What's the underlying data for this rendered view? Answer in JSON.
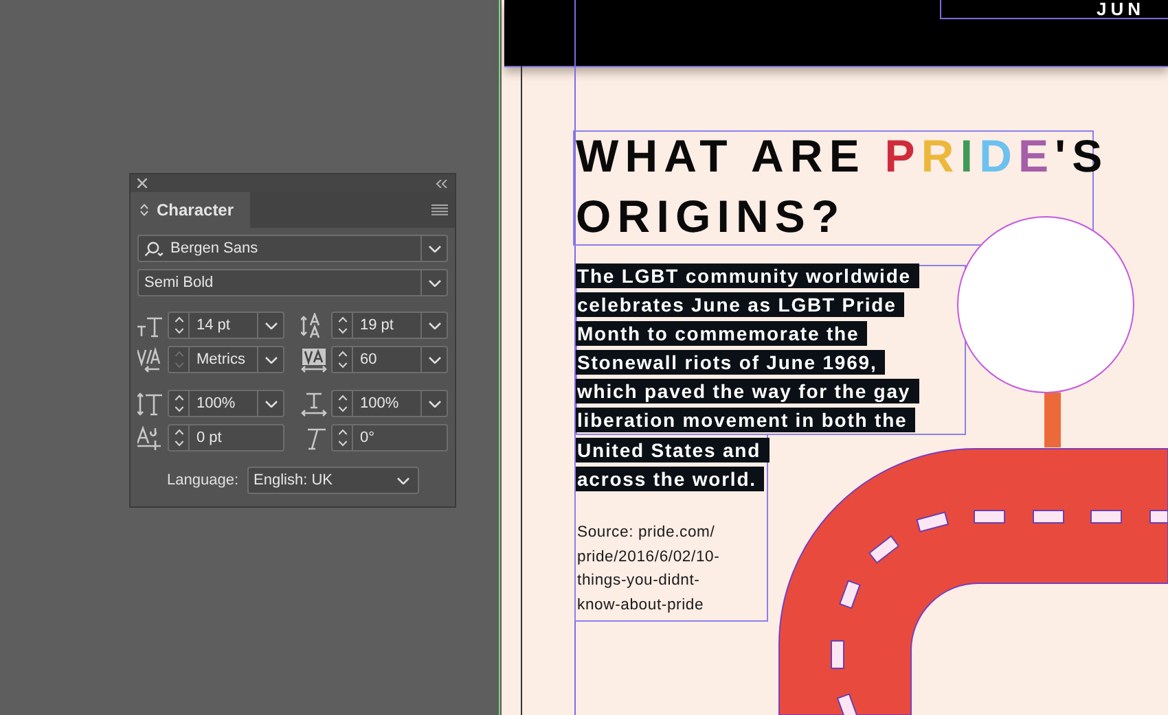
{
  "panel": {
    "title": "Character",
    "font_family": "Bergen Sans",
    "font_style": "Semi Bold",
    "fields": [
      {
        "kind": "font_size",
        "value": "14 pt",
        "has_dropdown": true,
        "disabled": false
      },
      {
        "kind": "leading",
        "value": "19 pt",
        "has_dropdown": true,
        "disabled": false
      },
      {
        "kind": "kerning",
        "value": "Metrics",
        "has_dropdown": true,
        "disabled": true
      },
      {
        "kind": "tracking",
        "value": "60",
        "has_dropdown": true,
        "disabled": false
      },
      {
        "kind": "vertical_scale",
        "value": "100%",
        "has_dropdown": true,
        "disabled": false
      },
      {
        "kind": "horizontal_scale",
        "value": "100%",
        "has_dropdown": true,
        "disabled": false
      },
      {
        "kind": "baseline_shift",
        "value": "0 pt",
        "has_dropdown": false,
        "disabled": false
      },
      {
        "kind": "skew",
        "value": "0°",
        "has_dropdown": false,
        "disabled": false
      }
    ],
    "language_label": "Language:",
    "language": "English: UK"
  },
  "document": {
    "banner_text": "JUN",
    "heading": {
      "before": "WHAT ARE ",
      "rainbow": [
        {
          "letter": "P",
          "color": "#d02b3b"
        },
        {
          "letter": "R",
          "color": "#ecb83c"
        },
        {
          "letter": "I",
          "color": "#3f9a5a"
        },
        {
          "letter": "D",
          "color": "#6cc1ef"
        },
        {
          "letter": "E",
          "color": "#a55ea7"
        }
      ],
      "after": "'S",
      "line2": "ORIGINS?"
    },
    "body_lines": [
      "The LGBT community worldwide",
      "celebrates June as LGBT Pride",
      "Month to commemorate the",
      "Stonewall riots of June 1969,",
      "which paved the way for the gay",
      "liberation movement in both the",
      "United States and",
      "across the world."
    ],
    "source_lines": [
      "Source: pride.com/",
      "pride/2016/6/02/10-",
      "things-you-didnt-",
      "know-about-pride"
    ]
  }
}
